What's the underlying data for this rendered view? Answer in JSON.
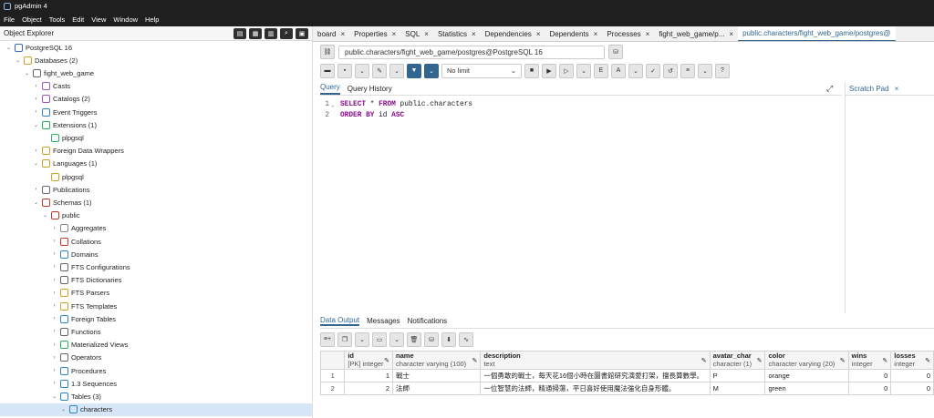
{
  "app": {
    "title": "pgAdmin 4"
  },
  "menu": [
    "File",
    "Object",
    "Tools",
    "Edit",
    "View",
    "Window",
    "Help"
  ],
  "explorer": {
    "title": "Object Explorer",
    "tree": [
      {
        "label": "PostgreSQL 16",
        "depth": 1,
        "open": true,
        "icon": "server-icon",
        "color": "#3b6ea8"
      },
      {
        "label": "Databases (2)",
        "depth": 2,
        "open": true,
        "icon": "databases-icon",
        "color": "#c9a227"
      },
      {
        "label": "fight_web_game",
        "depth": 3,
        "open": true,
        "icon": "database-icon",
        "color": "#666666"
      },
      {
        "label": "Casts",
        "depth": 4,
        "open": false,
        "icon": "casts-icon",
        "color": "#9b59b6"
      },
      {
        "label": "Catalogs (2)",
        "depth": 4,
        "open": false,
        "icon": "catalogs-icon",
        "color": "#9b59b6"
      },
      {
        "label": "Event Triggers",
        "depth": 4,
        "open": false,
        "icon": "event-triggers-icon",
        "color": "#2e86c1"
      },
      {
        "label": "Extensions (1)",
        "depth": 4,
        "open": true,
        "icon": "extensions-icon",
        "color": "#27ae60"
      },
      {
        "label": "plpgsql",
        "depth": 5,
        "open": null,
        "icon": "extension-icon",
        "color": "#27ae60"
      },
      {
        "label": "Foreign Data Wrappers",
        "depth": 4,
        "open": false,
        "icon": "fdw-icon",
        "color": "#c9a227"
      },
      {
        "label": "Languages (1)",
        "depth": 4,
        "open": true,
        "icon": "languages-icon",
        "color": "#c9a227"
      },
      {
        "label": "plpgsql",
        "depth": 5,
        "open": null,
        "icon": "language-icon",
        "color": "#c9a227"
      },
      {
        "label": "Publications",
        "depth": 4,
        "open": false,
        "icon": "publications-icon",
        "color": "#5d6d7e"
      },
      {
        "label": "Schemas (1)",
        "depth": 4,
        "open": true,
        "icon": "schemas-icon",
        "color": "#c0392b"
      },
      {
        "label": "public",
        "depth": 5,
        "open": true,
        "icon": "schema-icon",
        "color": "#c0392b"
      },
      {
        "label": "Aggregates",
        "depth": 6,
        "open": false,
        "icon": "aggregates-icon",
        "color": "#888888"
      },
      {
        "label": "Collations",
        "depth": 6,
        "open": false,
        "icon": "collations-icon",
        "color": "#c0392b"
      },
      {
        "label": "Domains",
        "depth": 6,
        "open": false,
        "icon": "domains-icon",
        "color": "#2e86c1"
      },
      {
        "label": "FTS Configurations",
        "depth": 6,
        "open": false,
        "icon": "fts-configurations-icon",
        "color": "#666666"
      },
      {
        "label": "FTS Dictionaries",
        "depth": 6,
        "open": false,
        "icon": "fts-dictionaries-icon",
        "color": "#666666"
      },
      {
        "label": "FTS Parsers",
        "depth": 6,
        "open": false,
        "icon": "fts-parsers-icon",
        "color": "#c9a227"
      },
      {
        "label": "FTS Templates",
        "depth": 6,
        "open": false,
        "icon": "fts-templates-icon",
        "color": "#c9a227"
      },
      {
        "label": "Foreign Tables",
        "depth": 6,
        "open": false,
        "icon": "foreign-tables-icon",
        "color": "#2e86c1"
      },
      {
        "label": "Functions",
        "depth": 6,
        "open": false,
        "icon": "functions-icon",
        "color": "#666666"
      },
      {
        "label": "Materialized Views",
        "depth": 6,
        "open": false,
        "icon": "materialized-views-icon",
        "color": "#27ae60"
      },
      {
        "label": "Operators",
        "depth": 6,
        "open": false,
        "icon": "operators-icon",
        "color": "#666666"
      },
      {
        "label": "Procedures",
        "depth": 6,
        "open": false,
        "icon": "procedures-icon",
        "color": "#2e86c1"
      },
      {
        "label": "1.3 Sequences",
        "depth": 6,
        "open": false,
        "icon": "sequences-icon",
        "color": "#2e86c1"
      },
      {
        "label": "Tables (3)",
        "depth": 6,
        "open": true,
        "icon": "tables-icon",
        "color": "#2e86c1"
      },
      {
        "label": "characters",
        "depth": 7,
        "open": true,
        "icon": "table-icon",
        "color": "#2e86c1",
        "selected": true
      }
    ]
  },
  "tabs": [
    {
      "label": "board",
      "active": false
    },
    {
      "label": "Properties",
      "active": false
    },
    {
      "label": "SQL",
      "active": false
    },
    {
      "label": "Statistics",
      "active": false
    },
    {
      "label": "Dependencies",
      "active": false
    },
    {
      "label": "Dependents",
      "active": false
    },
    {
      "label": "Processes",
      "active": false
    },
    {
      "label": "fight_web_game/p...",
      "active": false
    },
    {
      "label": "public.characters/fight_web_game/postgres@",
      "active": true
    }
  ],
  "connection": "public.characters/fight_web_game/postgres@PostgreSQL 16",
  "toolbar": {
    "limit_label": "No limit"
  },
  "editor_tabs": {
    "query": "Query",
    "history": "Query History",
    "scratch": "Scratch Pad"
  },
  "query_lines": [
    {
      "num": "1",
      "parts": [
        {
          "t": "SELECT",
          "kw": true
        },
        {
          "t": " * ",
          "kw": false
        },
        {
          "t": "FROM",
          "kw": true
        },
        {
          "t": " public.characters",
          "kw": false
        }
      ]
    },
    {
      "num": "2",
      "parts": [
        {
          "t": "ORDER BY",
          "kw": true
        },
        {
          "t": " id ",
          "kw": false
        },
        {
          "t": "ASC",
          "kw": true
        }
      ]
    }
  ],
  "output_tabs": {
    "data": "Data Output",
    "messages": "Messages",
    "notifications": "Notifications"
  },
  "grid": {
    "columns": [
      {
        "name": "id",
        "type": "[PK] integer"
      },
      {
        "name": "name",
        "type": "character varying (100)"
      },
      {
        "name": "description",
        "type": "text"
      },
      {
        "name": "avatar_char",
        "type": "character (1)"
      },
      {
        "name": "color",
        "type": "character varying (20)"
      },
      {
        "name": "wins",
        "type": "integer"
      },
      {
        "name": "losses",
        "type": "integer"
      }
    ],
    "rows": [
      {
        "rownum": "1",
        "id": "1",
        "name": "戰士",
        "description": "一個勇敢的戰士，每天花16個小時在圖書館研究演愛打架，擅長算數學。",
        "avatar_char": "P",
        "color": "orange",
        "wins": "0",
        "losses": "0"
      },
      {
        "rownum": "2",
        "id": "2",
        "name": "法師",
        "description": "一位智慧的法師，精通掃蕩，平日喜好使用魔法強化自身形體。",
        "avatar_char": "M",
        "color": "green",
        "wins": "0",
        "losses": "0"
      }
    ]
  }
}
